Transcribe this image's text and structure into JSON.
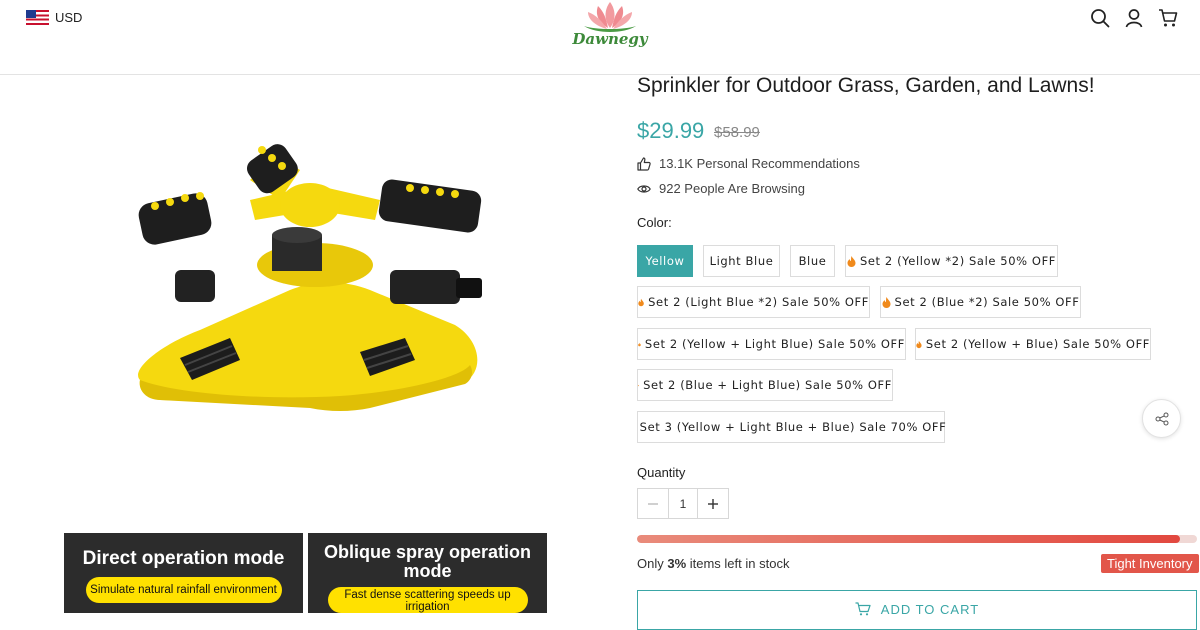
{
  "header": {
    "currency": "USD",
    "logo_text": "Dawnegy",
    "icons": [
      "search-icon",
      "user-icon",
      "cart-icon"
    ]
  },
  "gallery": {
    "banners": [
      {
        "title": "Direct operation mode",
        "pill": "Simulate natural rainfall environment"
      },
      {
        "title": "Oblique spray operation mode",
        "pill": "Fast dense scattering speeds up irrigation"
      }
    ]
  },
  "product": {
    "title": "Sprinkler for Outdoor Grass, Garden, and Lawns!",
    "price": "$29.99",
    "compare_price": "$58.99",
    "recommendations": "13.1K Personal Recommendations",
    "browsing": "922 People Are Browsing",
    "color_label": "Color:",
    "variants": [
      {
        "label": "Yellow",
        "selected": true,
        "hot": false
      },
      {
        "label": "Light Blue",
        "selected": false,
        "hot": false
      },
      {
        "label": "Blue",
        "selected": false,
        "hot": false
      },
      {
        "label": "Set 2 (Yellow *2) Sale 50% OFF",
        "selected": false,
        "hot": true
      },
      {
        "label": "Set 2 (Light Blue *2) Sale 50% OFF",
        "selected": false,
        "hot": true
      },
      {
        "label": "Set 2 (Blue *2) Sale 50% OFF",
        "selected": false,
        "hot": true
      },
      {
        "label": "Set 2 (Yellow + Light Blue) Sale 50% OFF",
        "selected": false,
        "hot": true
      },
      {
        "label": "Set 2 (Yellow + Blue) Sale 50% OFF",
        "selected": false,
        "hot": true
      },
      {
        "label": "Set 2 (Blue + Light Blue) Sale 50% OFF",
        "selected": false,
        "hot": true
      },
      {
        "label": "Set 3 (Yellow + Light Blue + Blue) Sale 70% OFF",
        "selected": false,
        "hot": true
      }
    ],
    "quantity_label": "Quantity",
    "quantity_value": "1",
    "stock": {
      "prefix": "Only ",
      "percent": "3%",
      "suffix": " items left in stock",
      "bar_fill_fraction": 0.97,
      "badge": "Tight Inventory"
    },
    "add_to_cart": "ADD TO CART"
  },
  "colors": {
    "accent": "#3aa6a6",
    "badge_red": "#e2564a",
    "product_yellow": "#f5d90f"
  }
}
